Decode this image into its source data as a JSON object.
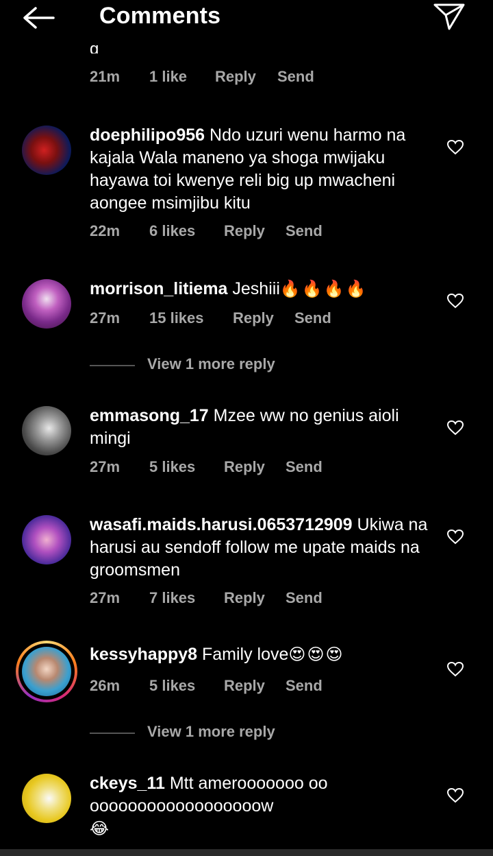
{
  "header": {
    "title": "Comments"
  },
  "top_partial": {
    "text": "g",
    "time": "21m",
    "likes": "1 like",
    "reply": "Reply",
    "send": "Send"
  },
  "comments": [
    {
      "username": "doephilipo956",
      "text": "Ndo uzuri wenu harmo na kajala Wala maneno ya shoga mwijaku hayawa toi kwenye reli big up mwacheni aongee msimjibu kitu",
      "time": "22m",
      "likes": "6 likes",
      "reply": "Reply",
      "send": "Send"
    },
    {
      "username": "morrison_litiema",
      "text": "Jeshiii",
      "emoji": "🔥🔥🔥🔥",
      "time": "27m",
      "likes": "15 likes",
      "reply": "Reply",
      "send": "Send",
      "view_more": "View 1 more reply"
    },
    {
      "username": "emmasong_17",
      "text": "Mzee ww no genius aioli mingi",
      "time": "27m",
      "likes": "5 likes",
      "reply": "Reply",
      "send": "Send"
    },
    {
      "username": "wasafi.maids.harusi.0653712909",
      "text": "Ukiwa na harusi au sendoff follow me upate maids na groomsmen",
      "time": "27m",
      "likes": "7 likes",
      "reply": "Reply",
      "send": "Send"
    },
    {
      "username": "kessyhappy8",
      "text": "Family love",
      "emoji": "😍😍😍",
      "time": "26m",
      "likes": "5 likes",
      "reply": "Reply",
      "send": "Send",
      "view_more": "View 1 more reply"
    },
    {
      "username": "ckeys_11",
      "text": "Mtt amerooooooo oooooooooooooooooooow",
      "emoji": "😂"
    }
  ],
  "colors": {
    "background": "#000000",
    "secondary_text": "#a8a8a8",
    "story_ring": "#e1306c"
  }
}
